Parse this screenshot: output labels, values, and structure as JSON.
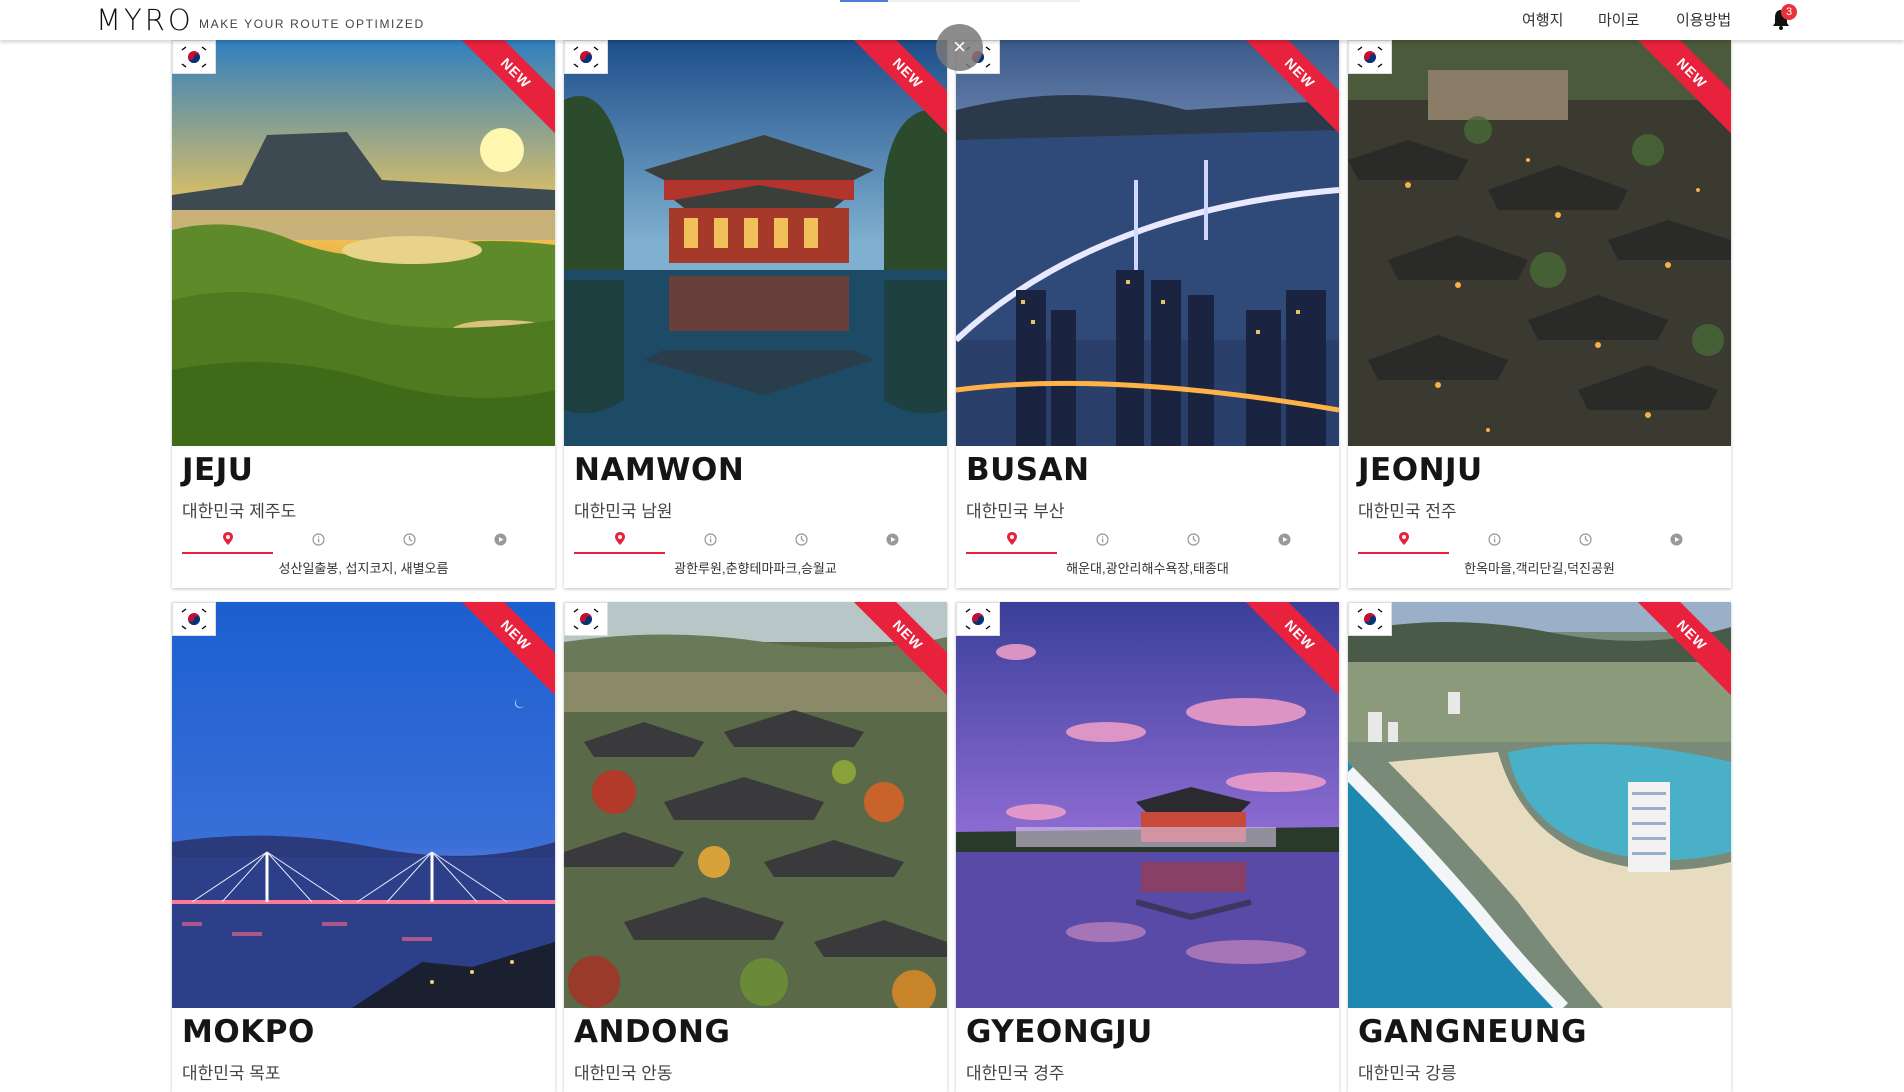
{
  "header": {
    "logo": "MYRO",
    "tagline": "MAKE YOUR ROUTE OPTIMIZED",
    "nav": [
      "여행지",
      "마이로",
      "이용방법"
    ],
    "notification_count": "3",
    "close_label": "×"
  },
  "ribbon_label": "NEW",
  "cards": [
    {
      "name": "JEJU",
      "subtitle": "대한민국 제주도",
      "spots": "성산일출봉, 섭지코지, 새별오름"
    },
    {
      "name": "NAMWON",
      "subtitle": "대한민국 남원",
      "spots": "광한루원,춘향테마파크,승월교"
    },
    {
      "name": "BUSAN",
      "subtitle": "대한민국 부산",
      "spots": "해운대,광안리해수욕장,태종대"
    },
    {
      "name": "JEONJU",
      "subtitle": "대한민국 전주",
      "spots": "한옥마을,객리단길,덕진공원"
    },
    {
      "name": "MOKPO",
      "subtitle": "대한민국 목포",
      "spots": ""
    },
    {
      "name": "ANDONG",
      "subtitle": "대한민국 안동",
      "spots": ""
    },
    {
      "name": "GYEONGJU",
      "subtitle": "대한민국 경주",
      "spots": ""
    },
    {
      "name": "GANGNEUNG",
      "subtitle": "대한민국 강릉",
      "spots": ""
    }
  ],
  "colors": {
    "accent": "#e8223c",
    "badge": "#e8323d"
  },
  "icons": [
    "map-pin-icon",
    "info-icon",
    "clock-icon",
    "play-icon",
    "bell-icon",
    "korea-flag-icon"
  ]
}
